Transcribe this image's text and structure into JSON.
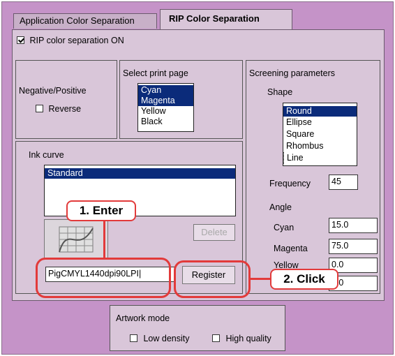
{
  "tabs": [
    {
      "label": "Application Color Separation",
      "active": false
    },
    {
      "label": "RIP Color Separation",
      "active": true
    }
  ],
  "rip_checkbox": {
    "label": "RIP color separation ON",
    "checked": true
  },
  "negpos": {
    "title": "Negative/Positive",
    "reverse_label": "Reverse",
    "reverse_checked": false
  },
  "print_page": {
    "title": "Select print page",
    "items": [
      {
        "label": "Cyan",
        "selected": true
      },
      {
        "label": "Magenta",
        "selected": true
      },
      {
        "label": "Yellow",
        "selected": false
      },
      {
        "label": "Black",
        "selected": false
      }
    ]
  },
  "screening": {
    "title": "Screening parameters",
    "shape_label": "Shape",
    "shapes": [
      {
        "label": "Round",
        "selected": true
      },
      {
        "label": "Ellipse",
        "selected": false
      },
      {
        "label": "Square",
        "selected": false
      },
      {
        "label": "Rhombus",
        "selected": false
      },
      {
        "label": "Line",
        "selected": false
      }
    ],
    "frequency_label": "Frequency",
    "frequency_value": "45",
    "angle_label": "Angle",
    "angles": [
      {
        "label": "Cyan",
        "value": "15.0"
      },
      {
        "label": "Magenta",
        "value": "75.0"
      },
      {
        "label": "Yellow",
        "value": "0.0"
      },
      {
        "label": "",
        "value": "5.0"
      }
    ]
  },
  "ink_curve": {
    "title": "Ink curve",
    "items": [
      {
        "label": "Standard",
        "selected": true
      }
    ],
    "delete_label": "Delete",
    "name_value": "PigCMYL1440dpi90LPI",
    "register_label": "Register"
  },
  "artwork": {
    "title": "Artwork mode",
    "low_density_label": "Low density",
    "high_quality_label": "High quality"
  },
  "annotations": {
    "enter_label": "1. Enter",
    "click_label": "2. Click",
    "color": "#e23a3a"
  }
}
